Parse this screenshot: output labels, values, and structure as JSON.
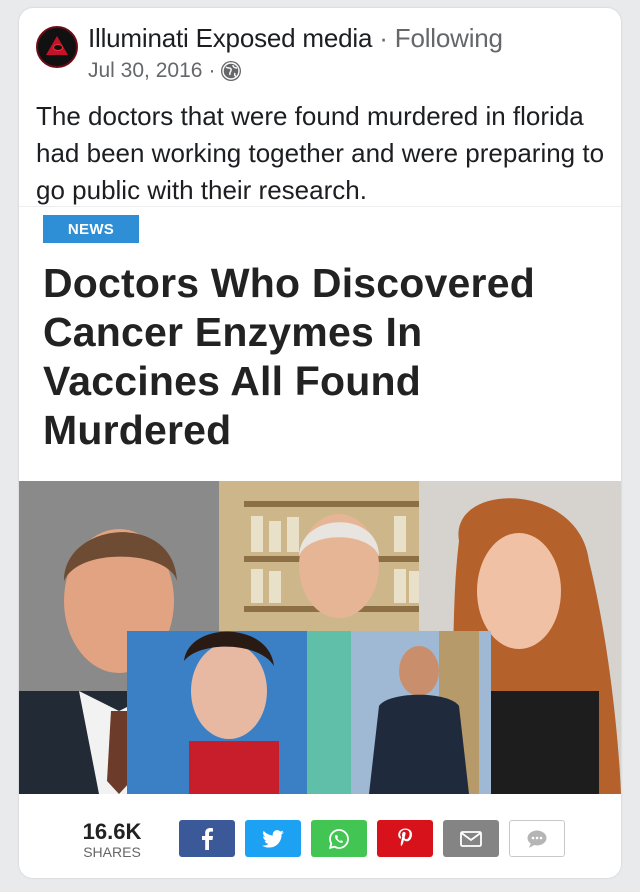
{
  "post": {
    "author": "Illuminati Exposed media",
    "separator": "·",
    "follow_status": "Following",
    "date": "Jul 30, 2016",
    "date_separator": "·",
    "privacy_icon": "globe-icon",
    "text": "The doctors that were found murdered in florida had been working together and were preparing to go public with their research."
  },
  "article": {
    "badge": "NEWS",
    "headline": "Doctors Who Discovered Cancer Enzymes In Vaccines All Found Murdered",
    "image_icon": "collage-photo"
  },
  "share": {
    "count": "16.6K",
    "count_label": "SHARES",
    "buttons": [
      {
        "name": "facebook",
        "icon": "facebook-icon",
        "color": "#3b5998"
      },
      {
        "name": "twitter",
        "icon": "twitter-icon",
        "color": "#1da1f2"
      },
      {
        "name": "whatsapp",
        "icon": "whatsapp-icon",
        "color": "#43c553"
      },
      {
        "name": "pinterest",
        "icon": "pinterest-icon",
        "color": "#d8121a"
      },
      {
        "name": "email",
        "icon": "email-icon",
        "color": "#848484"
      },
      {
        "name": "sms",
        "icon": "sms-icon",
        "color": "#ffffff"
      }
    ]
  },
  "colors": {
    "link_gray": "#65676b",
    "text": "#1c1e21",
    "badge_blue": "#2e8fd6"
  }
}
